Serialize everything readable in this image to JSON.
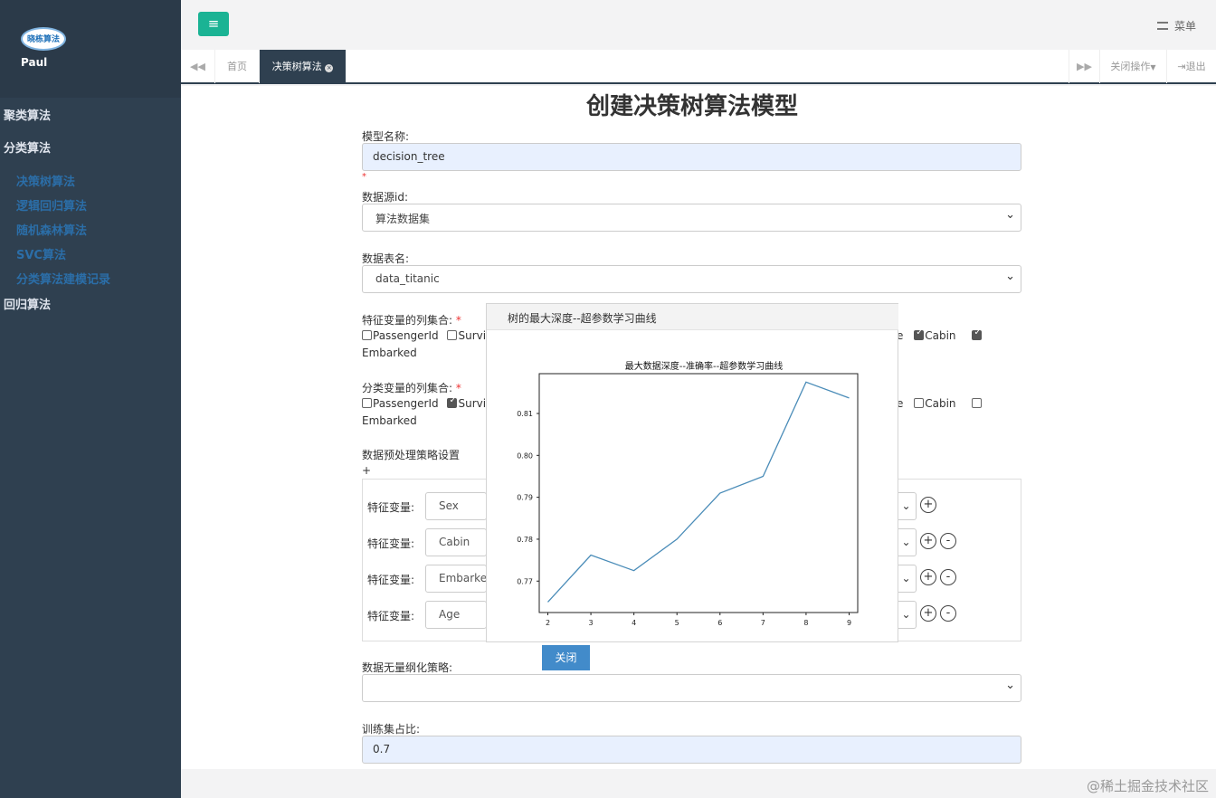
{
  "sidebar": {
    "logo_text": "晓栋算法",
    "user": "Paul",
    "items": [
      {
        "label": "聚类算法"
      },
      {
        "label": "分类算法"
      },
      {
        "label": "决策树算法"
      },
      {
        "label": "逻辑回归算法"
      },
      {
        "label": "随机森林算法"
      },
      {
        "label": "SVC算法"
      },
      {
        "label": "分类算法建模记录"
      },
      {
        "label": "回归算法"
      }
    ]
  },
  "topbar": {
    "menu_label": "菜单",
    "menu_icon": "list-icon",
    "toggle_icon": "hamburger-icon"
  },
  "tabs": {
    "home": "首页",
    "active": "决策树算法",
    "close_ops": "关闭操作",
    "logout": "退出"
  },
  "form": {
    "title": "创建决策树算法模型",
    "model_name_label": "模型名称:",
    "model_name_value": "decision_tree",
    "required_mark": "*",
    "datasource_label": "数据源id:",
    "datasource_value": "算法数据集",
    "table_label": "数据表名:",
    "table_value": "data_titanic",
    "feature_cols_label": "特征变量的列集合:",
    "feature_cols": {
      "c1": "PassengerId",
      "c2": "Survi",
      "c3": "e",
      "c4": "Cabin",
      "c5": "Embarked"
    },
    "class_cols_label": "分类变量的列集合:",
    "class_cols": {
      "c1": "PassengerId",
      "c2": "Survi",
      "c3": "e",
      "c4": "Cabin",
      "c5": "Embarked"
    },
    "preprocess_label": "数据预处理策略设置",
    "plus": "+",
    "strategy_rows": [
      {
        "label": "特征变量:",
        "value": "Sex"
      },
      {
        "label": "特征变量:",
        "value": "Cabin"
      },
      {
        "label": "特征变量:",
        "value": "Embarked"
      },
      {
        "label": "特征变量:",
        "value": "Age"
      }
    ],
    "scaling_label": "数据无量纲化策略:",
    "train_ratio_label": "训练集占比:",
    "train_ratio_value": "0.7"
  },
  "dialog": {
    "title": "树的最大深度--超参数学习曲线",
    "close_label": "关闭"
  },
  "chart_data": {
    "type": "line",
    "title": "最大数据深度--准确率--超参数学习曲线",
    "x": [
      2,
      3,
      4,
      5,
      6,
      7,
      8,
      9
    ],
    "series": [
      {
        "values": [
          0.765,
          0.7762,
          0.7725,
          0.78,
          0.791,
          0.795,
          0.8175,
          0.8137
        ]
      }
    ],
    "xlim": [
      1.8,
      9.2
    ],
    "ylim": [
      0.7625,
      0.8195
    ],
    "xticks": [
      "2",
      "3",
      "4",
      "5",
      "6",
      "7",
      "8",
      "9"
    ],
    "yticks": [
      "0.77",
      "0.78",
      "0.79",
      "0.80",
      "0.81"
    ],
    "grid": false,
    "line_color": "#4a8cb8"
  },
  "watermark": "@稀土掘金技术社区"
}
